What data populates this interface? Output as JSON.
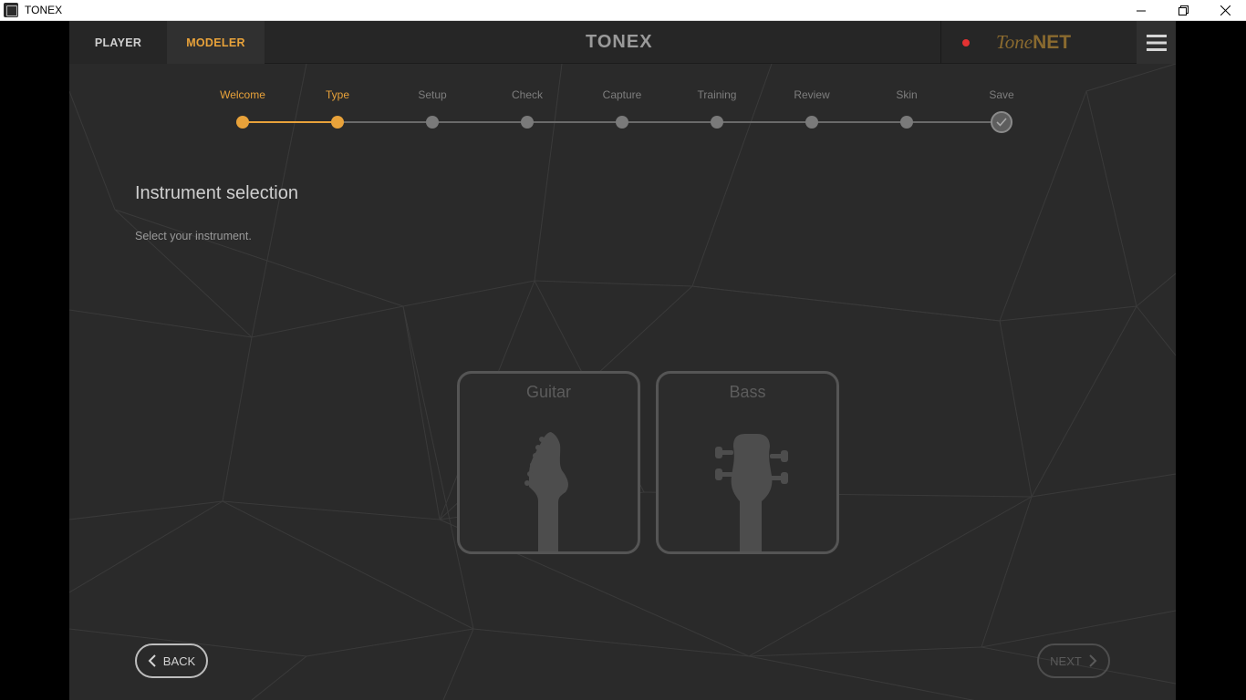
{
  "window": {
    "title": "TONEX",
    "minimize_icon": "minimize-icon",
    "restore_icon": "restore-icon",
    "close_icon": "close-icon"
  },
  "header": {
    "tabs": [
      {
        "label": "PLAYER",
        "active": false
      },
      {
        "label": "MODELER",
        "active": true
      }
    ],
    "logo": "TONEX",
    "tonenet": {
      "part1": "Tone",
      "part2": "NET"
    },
    "record_indicator_color": "#e33232",
    "menu_icon": "hamburger-menu-icon"
  },
  "stepper": {
    "steps": [
      {
        "label": "Welcome",
        "state": "done"
      },
      {
        "label": "Type",
        "state": "current"
      },
      {
        "label": "Setup",
        "state": "pending"
      },
      {
        "label": "Check",
        "state": "pending"
      },
      {
        "label": "Capture",
        "state": "pending"
      },
      {
        "label": "Training",
        "state": "pending"
      },
      {
        "label": "Review",
        "state": "pending"
      },
      {
        "label": "Skin",
        "state": "pending"
      },
      {
        "label": "Save",
        "state": "final"
      }
    ]
  },
  "content": {
    "title": "Instrument selection",
    "subtitle": "Select your instrument.",
    "instruments": [
      {
        "label": "Guitar",
        "icon": "guitar-headstock-icon"
      },
      {
        "label": "Bass",
        "icon": "bass-headstock-icon"
      }
    ]
  },
  "footer": {
    "back_label": "BACK",
    "next_label": "NEXT",
    "next_enabled": false
  },
  "colors": {
    "accent": "#e8a23a",
    "background": "#2a2a2a",
    "header": "#262626",
    "inactive_step": "#7a7a7a"
  }
}
